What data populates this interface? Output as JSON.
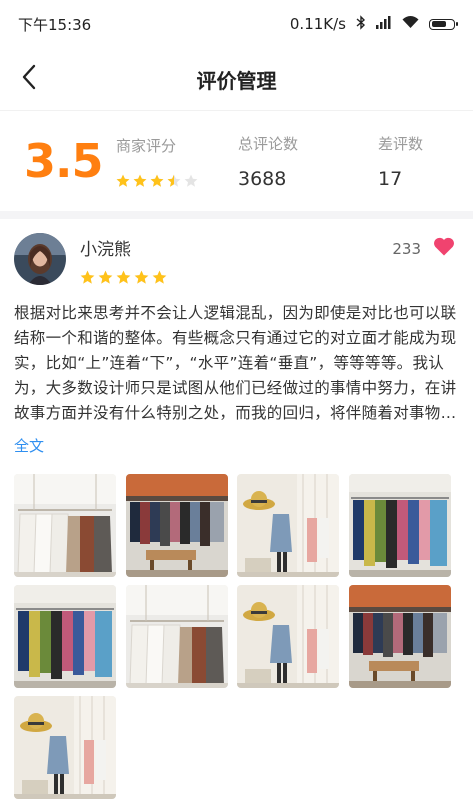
{
  "status_bar": {
    "time": "下午15:36",
    "network_speed": "0.11K/s",
    "icons": [
      "bluetooth-icon",
      "signal-icon",
      "wifi-icon",
      "battery-icon"
    ],
    "battery_level": 0.8
  },
  "nav": {
    "title": "评价管理",
    "back_icon": "chevron-left-icon"
  },
  "summary": {
    "score": "3.5",
    "merchant_label": "商家评分",
    "merchant_rating": 3.5,
    "total_label": "总评论数",
    "total_value": "3688",
    "bad_label": "差评数",
    "bad_value": "17"
  },
  "review": {
    "username": "小浣熊",
    "rating": 5,
    "likes": "233",
    "like_icon": "heart-icon",
    "text": "根据对比来思考并不会让人逻辑混乱，因为即使是对比也可以联结称一个和谐的整体。有些概念只有通过它的对立面才能成为现实，比如“上”连着“下”，“水平”连着“垂直”，等等等等。我认为，大多数设计师只是试图从他们已经做过的事情中努力，在讲故事方面并没有什么特别之处，而我的回归，将伴随着对事物的重新思考……",
    "full_text_link": "全文",
    "photos": [
      {
        "scene": "white-shirts-rack"
      },
      {
        "scene": "dark-store"
      },
      {
        "scene": "hat-mannequin"
      },
      {
        "scene": "colorful-rack"
      },
      {
        "scene": "colorful-rack"
      },
      {
        "scene": "white-shirts-rack"
      },
      {
        "scene": "hat-mannequin"
      },
      {
        "scene": "dark-store"
      },
      {
        "scene": "hat-mannequin"
      }
    ]
  },
  "colors": {
    "accent_orange": "#ff7f10",
    "star_yellow": "#ffc21a",
    "heart_pink": "#f0436f",
    "link_blue": "#2f8ff0"
  }
}
